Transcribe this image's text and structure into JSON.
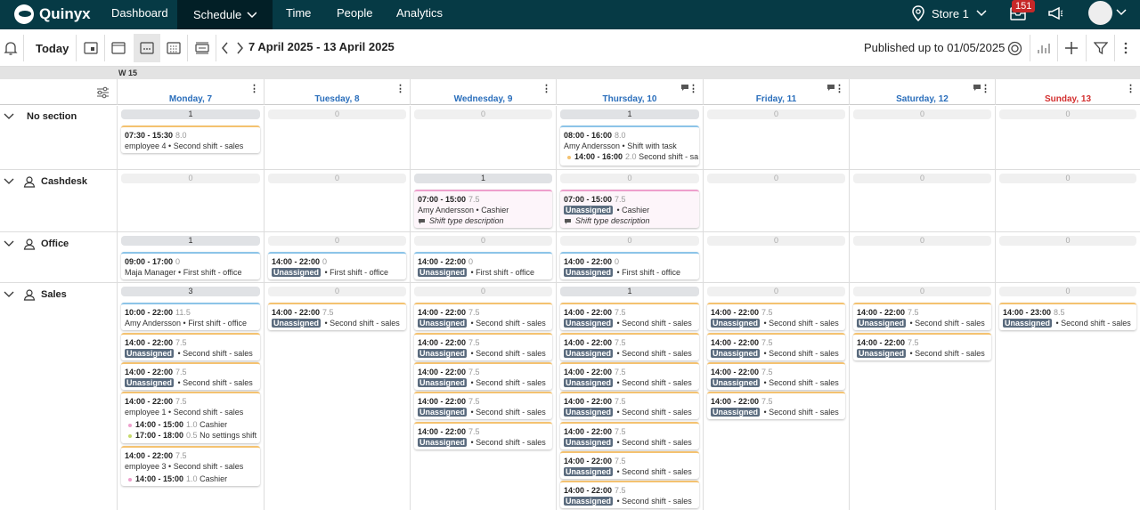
{
  "nav": {
    "brand": "Quinyx",
    "items": [
      "Dashboard",
      "Schedule",
      "Time",
      "People",
      "Analytics"
    ],
    "store": "Store 1",
    "notification_count": "151"
  },
  "toolbar": {
    "today": "Today",
    "date_range": "7 April 2025 - 13 April 2025",
    "published": "Published up to 01/05/2025"
  },
  "week_label": "W 15",
  "days": [
    "Monday, 7",
    "Tuesday, 8",
    "Wednesday, 9",
    "Thursday, 10",
    "Friday, 11",
    "Saturday, 12",
    "Sunday, 13"
  ],
  "sections": [
    {
      "name": "No section",
      "counts": [
        "1",
        "0",
        "0",
        "1",
        "0",
        "0",
        "0"
      ]
    },
    {
      "name": "Cashdesk",
      "counts": [
        "0",
        "0",
        "1",
        "0",
        "0",
        "0",
        "0"
      ]
    },
    {
      "name": "Office",
      "counts": [
        "1",
        "0",
        "0",
        "0",
        "0",
        "0",
        "0"
      ]
    },
    {
      "name": "Sales",
      "counts": [
        "3",
        "0",
        "0",
        "1",
        "0",
        "0",
        "0"
      ]
    }
  ],
  "shifts": {
    "employee4": {
      "time": "07:30 - 15:30",
      "hours": "8.0",
      "who": "employee 4",
      "type": "Second shift - sales"
    },
    "amy_task": {
      "time": "08:00 - 16:00",
      "hours": "8.0",
      "who": "Amy Andersson",
      "type": "Shift with task",
      "sub_time": "14:00 - 16:00",
      "sub_hours": "2.0",
      "sub_type": "Second shift - sa"
    },
    "amy_cashier": {
      "time": "07:00 - 15:00",
      "hours": "7.5",
      "who": "Amy Andersson",
      "type": "Cashier",
      "desc": "Shift type description"
    },
    "una_cashier": {
      "time": "07:00 - 15:00",
      "hours": "7.5",
      "who": "Unassigned",
      "type": "Cashier",
      "desc": "Shift type description"
    },
    "maja": {
      "time": "09:00 - 17:00",
      "hours": "0",
      "who": "Maja Manager",
      "type": "First shift - office"
    },
    "office_una": {
      "time": "14:00 - 22:00",
      "hours": "0",
      "who": "Unassigned",
      "type": "First shift - office"
    },
    "amy_office": {
      "time": "10:00 - 22:00",
      "hours": "11.5",
      "who": "Amy Andersson",
      "type": "First shift - office"
    },
    "sales_una": {
      "time": "14:00 - 22:00",
      "hours": "7.5",
      "who": "Unassigned",
      "type": "Second shift - sales"
    },
    "emp1": {
      "time": "14:00 - 22:00",
      "hours": "7.5",
      "who": "employee 1",
      "type": "Second shift - sales",
      "sub1_time": "14:00 - 15:00",
      "sub1_hours": "1.0",
      "sub1_type": "Cashier",
      "sub2_time": "17:00 - 18:00",
      "sub2_hours": "0.5",
      "sub2_type": "No settings shift"
    },
    "emp3": {
      "time": "14:00 - 22:00",
      "hours": "7.5",
      "who": "employee 3",
      "type": "Second shift - sales",
      "sub_time": "14:00 - 15:00",
      "sub_hours": "1.0",
      "sub_type": "Cashier"
    },
    "sunday_una": {
      "time": "14:00 - 23:00",
      "hours": "8.5",
      "who": "Unassigned",
      "type": "Second shift - sales"
    }
  },
  "colors": {
    "nav_bg": "#063a45",
    "orange": "#f4c270",
    "blue": "#8cc4e8",
    "pink": "#ee9fcc",
    "sunday": "#d32f2f",
    "day": "#2a6ebb"
  }
}
